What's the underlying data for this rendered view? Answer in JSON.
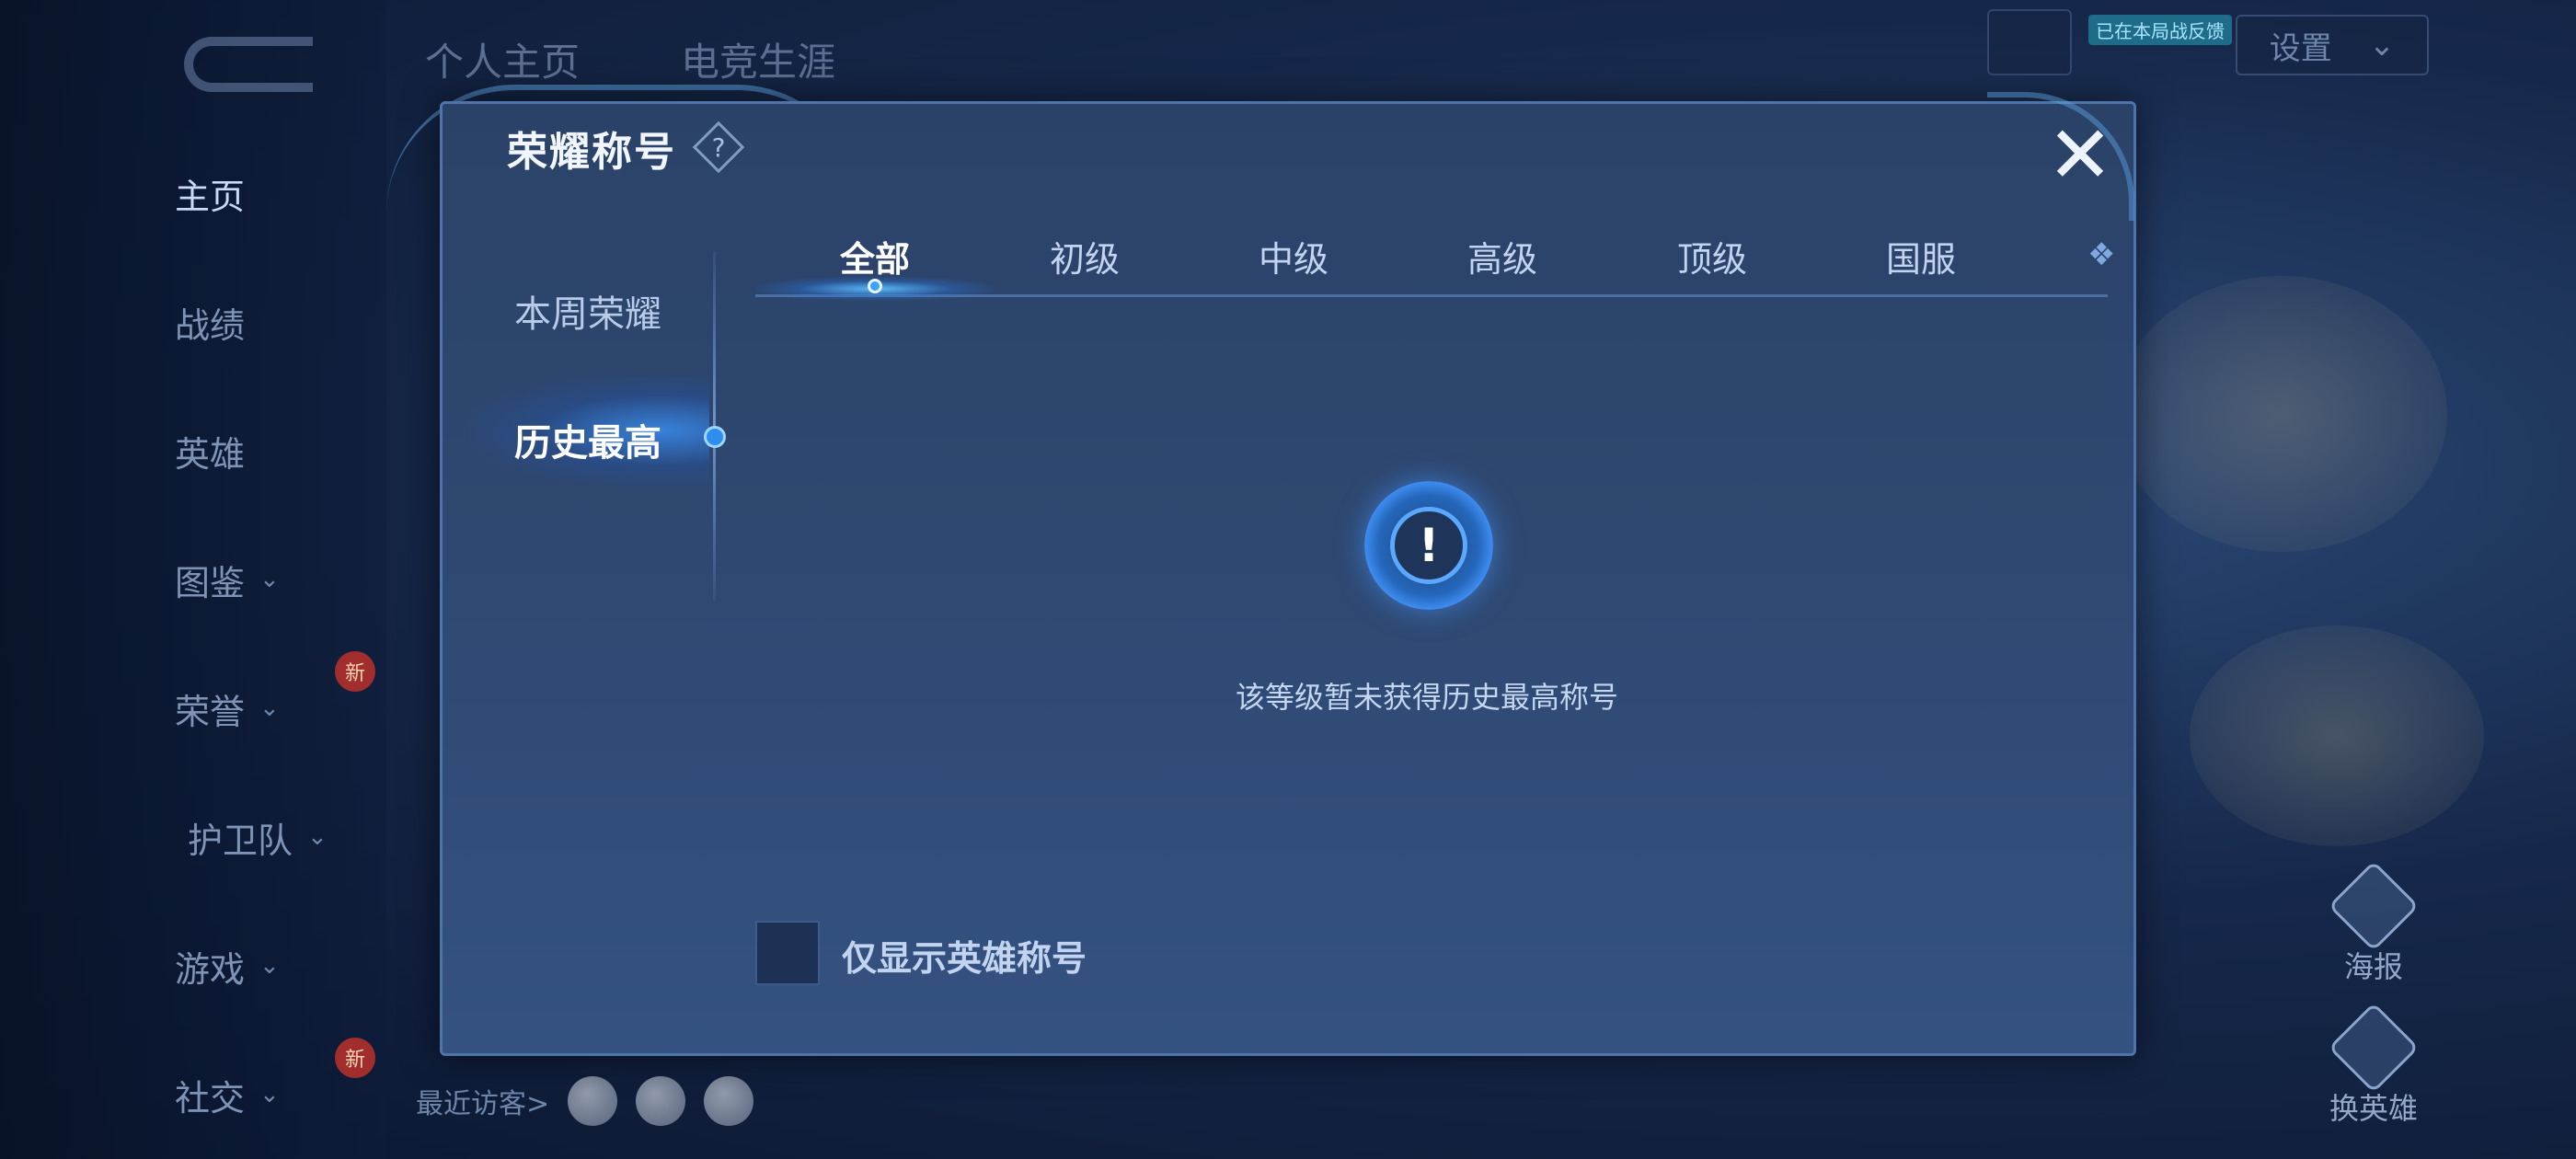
{
  "background": {
    "top_tabs": [
      "个人主页",
      "电竞生涯"
    ],
    "sidebar": [
      {
        "label": "主页",
        "active": true,
        "chevron": false,
        "new": false
      },
      {
        "label": "战绩",
        "active": false,
        "chevron": false,
        "new": false
      },
      {
        "label": "英雄",
        "active": false,
        "chevron": false,
        "new": false
      },
      {
        "label": "图鉴",
        "active": false,
        "chevron": true,
        "new": false
      },
      {
        "label": "荣誉",
        "active": false,
        "chevron": true,
        "new": true
      },
      {
        "label": "护卫队",
        "active": false,
        "chevron": true,
        "new": false
      },
      {
        "label": "游戏",
        "active": false,
        "chevron": true,
        "new": false
      },
      {
        "label": "社交",
        "active": false,
        "chevron": true,
        "new": true
      }
    ],
    "new_badge": "新",
    "settings_label": "设置",
    "live_tag": "已在本局战反馈",
    "recent_visitors_label": "最近访客>",
    "right_buttons": [
      "海报",
      "换英雄"
    ]
  },
  "modal": {
    "title": "荣耀称号",
    "help_icon": "?",
    "close_icon": "✕",
    "side_tabs": [
      {
        "label": "本周荣耀",
        "active": false
      },
      {
        "label": "历史最高",
        "active": true
      }
    ],
    "level_tabs": [
      {
        "label": "全部",
        "active": true
      },
      {
        "label": "初级",
        "active": false
      },
      {
        "label": "中级",
        "active": false
      },
      {
        "label": "高级",
        "active": false
      },
      {
        "label": "顶级",
        "active": false
      },
      {
        "label": "国服",
        "active": false
      }
    ],
    "more_tabs_icon": "❖",
    "empty_state": {
      "icon": "!",
      "message": "该等级暂未获得历史最高称号"
    },
    "filter_checkbox": {
      "label": "仅显示英雄称号",
      "checked": false
    }
  },
  "colors": {
    "modal_bg": "#2f4a74",
    "accent_blue": "#3da2ff",
    "text_primary": "#ffffff",
    "text_secondary": "#c2d4ef"
  }
}
